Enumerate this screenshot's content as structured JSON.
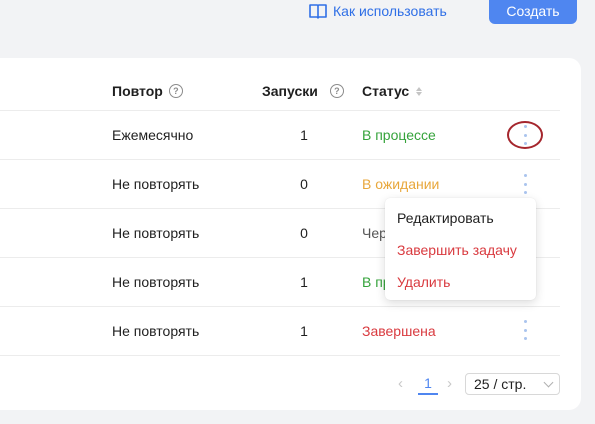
{
  "header": {
    "howto_label": "Как использовать",
    "create_label": "Создать",
    "accent_color": "#4f86f0"
  },
  "table": {
    "columns": {
      "repeat": "Повтор",
      "runs": "Запуски",
      "status": "Статус"
    },
    "rows": [
      {
        "repeat": "Ежемесячно",
        "runs": "1",
        "status": "В процессе"
      },
      {
        "repeat": "Не повторять",
        "runs": "0",
        "status": "В ожидании"
      },
      {
        "repeat": "Не повторять",
        "runs": "0",
        "status": "Чер"
      },
      {
        "repeat": "Не повторять",
        "runs": "1",
        "status": "В пр"
      },
      {
        "repeat": "Не повторять",
        "runs": "1",
        "status": "Завершена"
      }
    ]
  },
  "context_menu": {
    "edit": "Редактировать",
    "finish": "Завершить задачу",
    "delete": "Удалить"
  },
  "pagination": {
    "current_page": "1",
    "page_size": "25 / стр."
  }
}
